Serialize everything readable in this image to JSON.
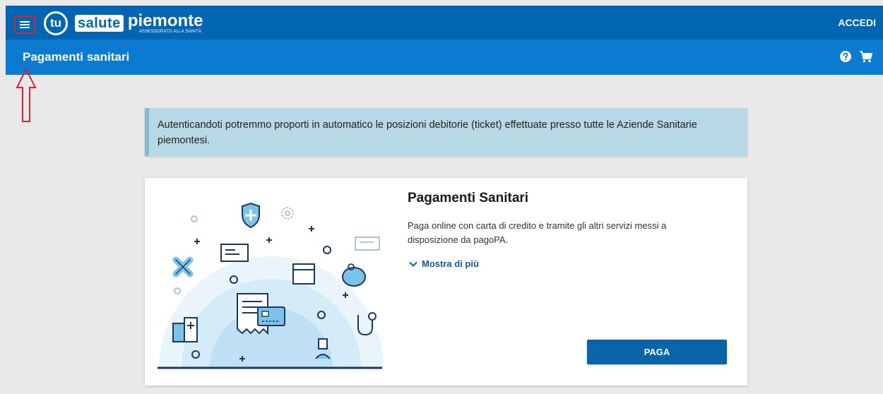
{
  "header": {
    "logo_tu": "tu",
    "logo_salute": "salute",
    "logo_piemonte": "piemonte",
    "logo_subtitle": "ASSESSORATO ALLA SANITÀ",
    "login_label": "ACCEDI"
  },
  "subheader": {
    "title": "Pagamenti sanitari"
  },
  "notice": {
    "text": "Autenticandoti potremmo proporti in automatico le posizioni debitorie (ticket) effettuate presso tutte le Aziende Sanitarie piemontesi."
  },
  "card": {
    "title": "Pagamenti Sanitari",
    "description": "Paga online con carta di credito e tramite gli altri servizi messi a disposizione da pagoPA.",
    "more_label": "Mostra di più",
    "pay_label": "PAGA"
  },
  "colors": {
    "header_bg": "#0066b3",
    "subheader_bg": "#0a7bd0",
    "annotation_red": "#d9262e",
    "notice_bg": "#b7d8e5",
    "button_bg": "#0a64aa"
  }
}
